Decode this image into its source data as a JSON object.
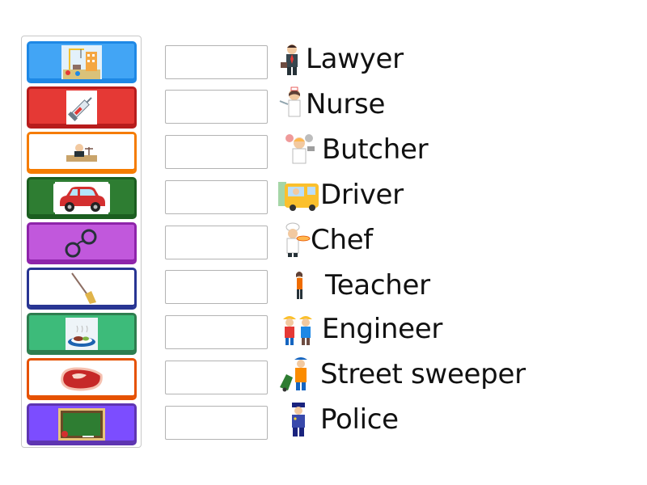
{
  "tiles": [
    {
      "icon": "construction-scene-icon",
      "border": "#1e88e5",
      "fill": "#42a5f5",
      "inner": "#42a5f5"
    },
    {
      "icon": "syringe-icon",
      "border": "#b71c1c",
      "fill": "#e53935",
      "inner": "#ffffff"
    },
    {
      "icon": "judge-icon",
      "border": "#f57c00",
      "fill": "#ffffff",
      "inner": "#ffffff"
    },
    {
      "icon": "red-car-icon",
      "border": "#1b5e20",
      "fill": "#2e7d32",
      "inner": "#ffffff"
    },
    {
      "icon": "handcuffs-icon",
      "border": "#8e24aa",
      "fill": "#c158dc",
      "inner": "#c158dc"
    },
    {
      "icon": "broom-icon",
      "border": "#283593",
      "fill": "#ffffff",
      "inner": "#ffffff"
    },
    {
      "icon": "food-plate-icon",
      "border": "#2e7d4f",
      "fill": "#3dbb7a",
      "inner": "#3dbb7a"
    },
    {
      "icon": "steak-icon",
      "border": "#e65100",
      "fill": "#ffffff",
      "inner": "#ffffff"
    },
    {
      "icon": "chalkboard-icon",
      "border": "#5e35b1",
      "fill": "#7c4dff",
      "inner": "#7c4dff"
    }
  ],
  "answers": [
    {
      "label": "Lawyer",
      "icon": "lawyer-icon"
    },
    {
      "label": "Nurse",
      "icon": "nurse-icon"
    },
    {
      "label": "Butcher",
      "icon": "butcher-icon"
    },
    {
      "label": "Driver",
      "icon": "bus-driver-icon"
    },
    {
      "label": "Chef",
      "icon": "chef-icon"
    },
    {
      "label": "Teacher",
      "icon": "teacher-icon"
    },
    {
      "label": "Engineer",
      "icon": "engineers-icon"
    },
    {
      "label": "Street sweeper",
      "icon": "street-sweeper-icon"
    },
    {
      "label": "Police",
      "icon": "police-officer-icon"
    }
  ]
}
